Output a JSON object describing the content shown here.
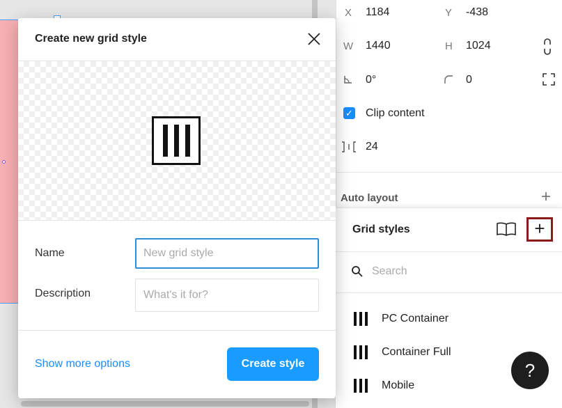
{
  "properties": {
    "x_label": "X",
    "x_value": "1184",
    "y_label": "Y",
    "y_value": "-438",
    "w_label": "W",
    "w_value": "1440",
    "h_label": "H",
    "h_value": "1024",
    "rotation_value": "0°",
    "corner_radius_value": "0",
    "clip_content_label": "Clip content",
    "clip_content_checked": true,
    "spacing_value": "24"
  },
  "auto_layout": {
    "title": "Auto layout"
  },
  "grid_styles": {
    "title": "Grid styles",
    "search_placeholder": "Search",
    "items": [
      {
        "label": "PC Container"
      },
      {
        "label": "Container Full"
      },
      {
        "label": "Mobile"
      }
    ]
  },
  "help": {
    "label": "?"
  },
  "modal": {
    "title": "Create new grid style",
    "name_label": "Name",
    "name_placeholder": "New grid style",
    "description_label": "Description",
    "description_placeholder": "What's it for?",
    "show_more_label": "Show more options",
    "create_label": "Create style"
  },
  "colors": {
    "accent": "#1a9bff",
    "highlight": "#8b1a1a",
    "canvas_frame": "#f7b0b3"
  }
}
